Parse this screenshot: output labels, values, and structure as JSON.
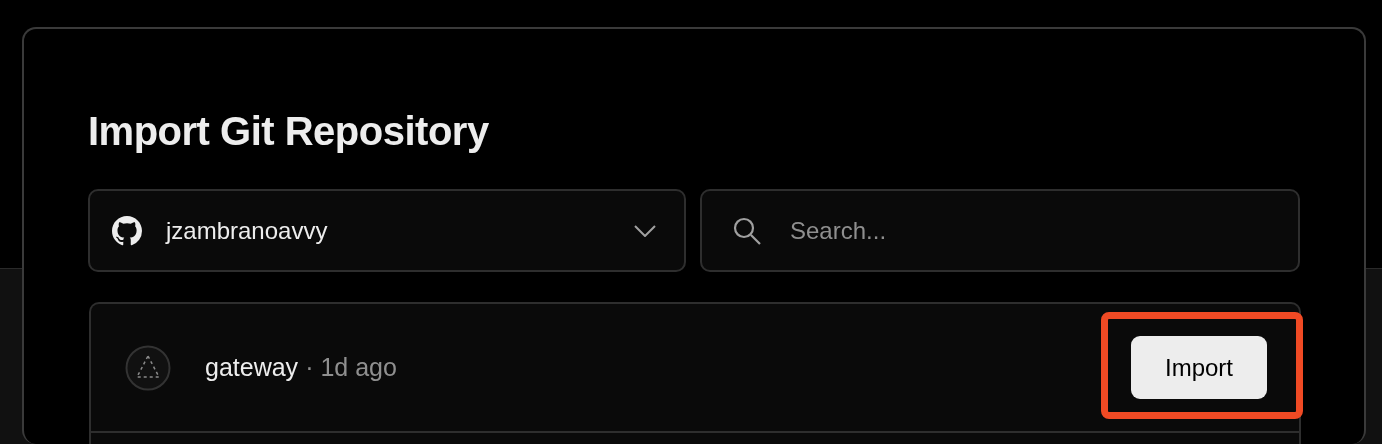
{
  "title": "Import Git Repository",
  "account_select": {
    "value": "jzambranoavvy"
  },
  "search": {
    "placeholder": "Search..."
  },
  "repositories": [
    {
      "name": "gateway",
      "age": "· 1d ago",
      "action": "Import",
      "highlighted": true
    }
  ]
}
